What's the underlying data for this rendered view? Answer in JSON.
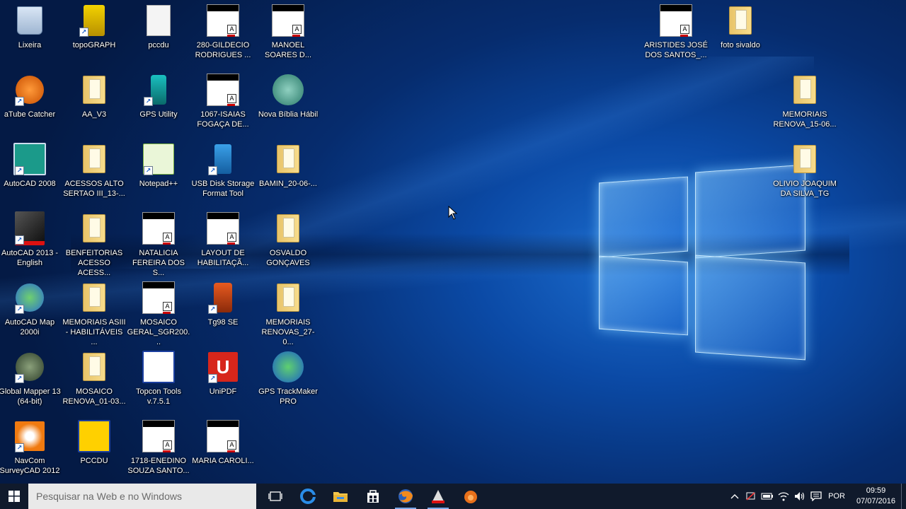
{
  "desktop": {
    "icons": [
      {
        "label": "Lixeira",
        "icon": "recycle-bin-icon"
      },
      {
        "label": "topoGRAPH",
        "icon": "topograph-icon"
      },
      {
        "label": "pccdu",
        "icon": "document-icon"
      },
      {
        "label": "280-GILDECIO RODRIGUES ...",
        "icon": "drawing-file-icon"
      },
      {
        "label": "MANOEL SOARES D...",
        "icon": "drawing-file-icon"
      },
      {
        "label": "ARISTIDES JOSÉ DOS SANTOS_...",
        "icon": "drawing-file-icon"
      },
      {
        "label": "foto sivaldo",
        "icon": "folder-icon"
      },
      {
        "label": "aTube Catcher",
        "icon": "atube-catcher-icon"
      },
      {
        "label": "AA_V3",
        "icon": "folder-icon"
      },
      {
        "label": "GPS Utility",
        "icon": "gps-utility-icon"
      },
      {
        "label": "1067-ISAIAS FOGAÇA DE...",
        "icon": "drawing-file-icon"
      },
      {
        "label": "Nova Bíblia Hábil",
        "icon": "bible-icon"
      },
      {
        "label": "MEMORIAIS RENOVA_15-06...",
        "icon": "folder-icon"
      },
      {
        "label": "AutoCAD 2008",
        "icon": "autocad-2008-icon"
      },
      {
        "label": "ACESSOS ALTO SERTAO III_13-...",
        "icon": "folder-icon"
      },
      {
        "label": "Notepad++",
        "icon": "notepadpp-icon"
      },
      {
        "label": "USB Disk Storage Format Tool",
        "icon": "usb-icon"
      },
      {
        "label": "BAMIN_20-06-...",
        "icon": "folder-icon"
      },
      {
        "label": "OLIVIO JOAQUIM DA SILVA_TG",
        "icon": "folder-icon"
      },
      {
        "label": "AutoCAD 2013 - English",
        "icon": "autocad-2013-icon"
      },
      {
        "label": "BENFEITORIAS ACESSO ACESS...",
        "icon": "folder-icon"
      },
      {
        "label": "NATALICIA FEREIRA DOS S...",
        "icon": "drawing-file-icon"
      },
      {
        "label": "LAYOUT DE HABILITAÇÃ...",
        "icon": "drawing-file-icon"
      },
      {
        "label": "OSVALDO GONÇAVES",
        "icon": "folder-icon"
      },
      {
        "label": "AutoCAD Map 2000i",
        "icon": "autocad-map-icon"
      },
      {
        "label": "MEMORIAIS ASIII - HABILITÁVEIS ...",
        "icon": "folder-icon"
      },
      {
        "label": "MOSAICO GERAL_SGR200...",
        "icon": "drawing-file-icon"
      },
      {
        "label": "Tg98 SE",
        "icon": "total-station-icon"
      },
      {
        "label": "MEMORIAIS RENOVAS_27-0...",
        "icon": "folder-icon"
      },
      {
        "label": "Global Mapper 13 (64-bit)",
        "icon": "global-mapper-icon"
      },
      {
        "label": "MOSAICO RENOVA_01-03...",
        "icon": "folder-icon"
      },
      {
        "label": "Topcon Tools v.7.5.1",
        "icon": "topcon-icon"
      },
      {
        "label": "UniPDF",
        "icon": "unipdf-icon"
      },
      {
        "label": "GPS TrackMaker PRO",
        "icon": "gps-trackmaker-icon"
      },
      {
        "label": "NavCom SurveyCAD 2012",
        "icon": "navcom-icon"
      },
      {
        "label": "PCCDU",
        "icon": "pccdu-icon"
      },
      {
        "label": "1718-ENEDINO SOUZA SANTO...",
        "icon": "drawing-file-icon"
      },
      {
        "label": "MARIA CAROLI...",
        "icon": "drawing-file-icon"
      }
    ]
  },
  "taskbar": {
    "search_placeholder": "Pesquisar na Web e no Windows",
    "pinned": [
      {
        "icon": "task-view-icon"
      },
      {
        "icon": "edge-icon"
      },
      {
        "icon": "file-explorer-icon"
      },
      {
        "icon": "store-icon"
      },
      {
        "icon": "firefox-icon"
      },
      {
        "icon": "autocad-icon"
      },
      {
        "icon": "atube-catcher-icon"
      }
    ],
    "tray": {
      "language": "POR",
      "time": "09:59",
      "date": "07/07/2016"
    }
  },
  "colors": {
    "taskbar_bg": "#101a2c",
    "search_bg": "#e9e9e9",
    "accent": "#1d6fd1"
  }
}
